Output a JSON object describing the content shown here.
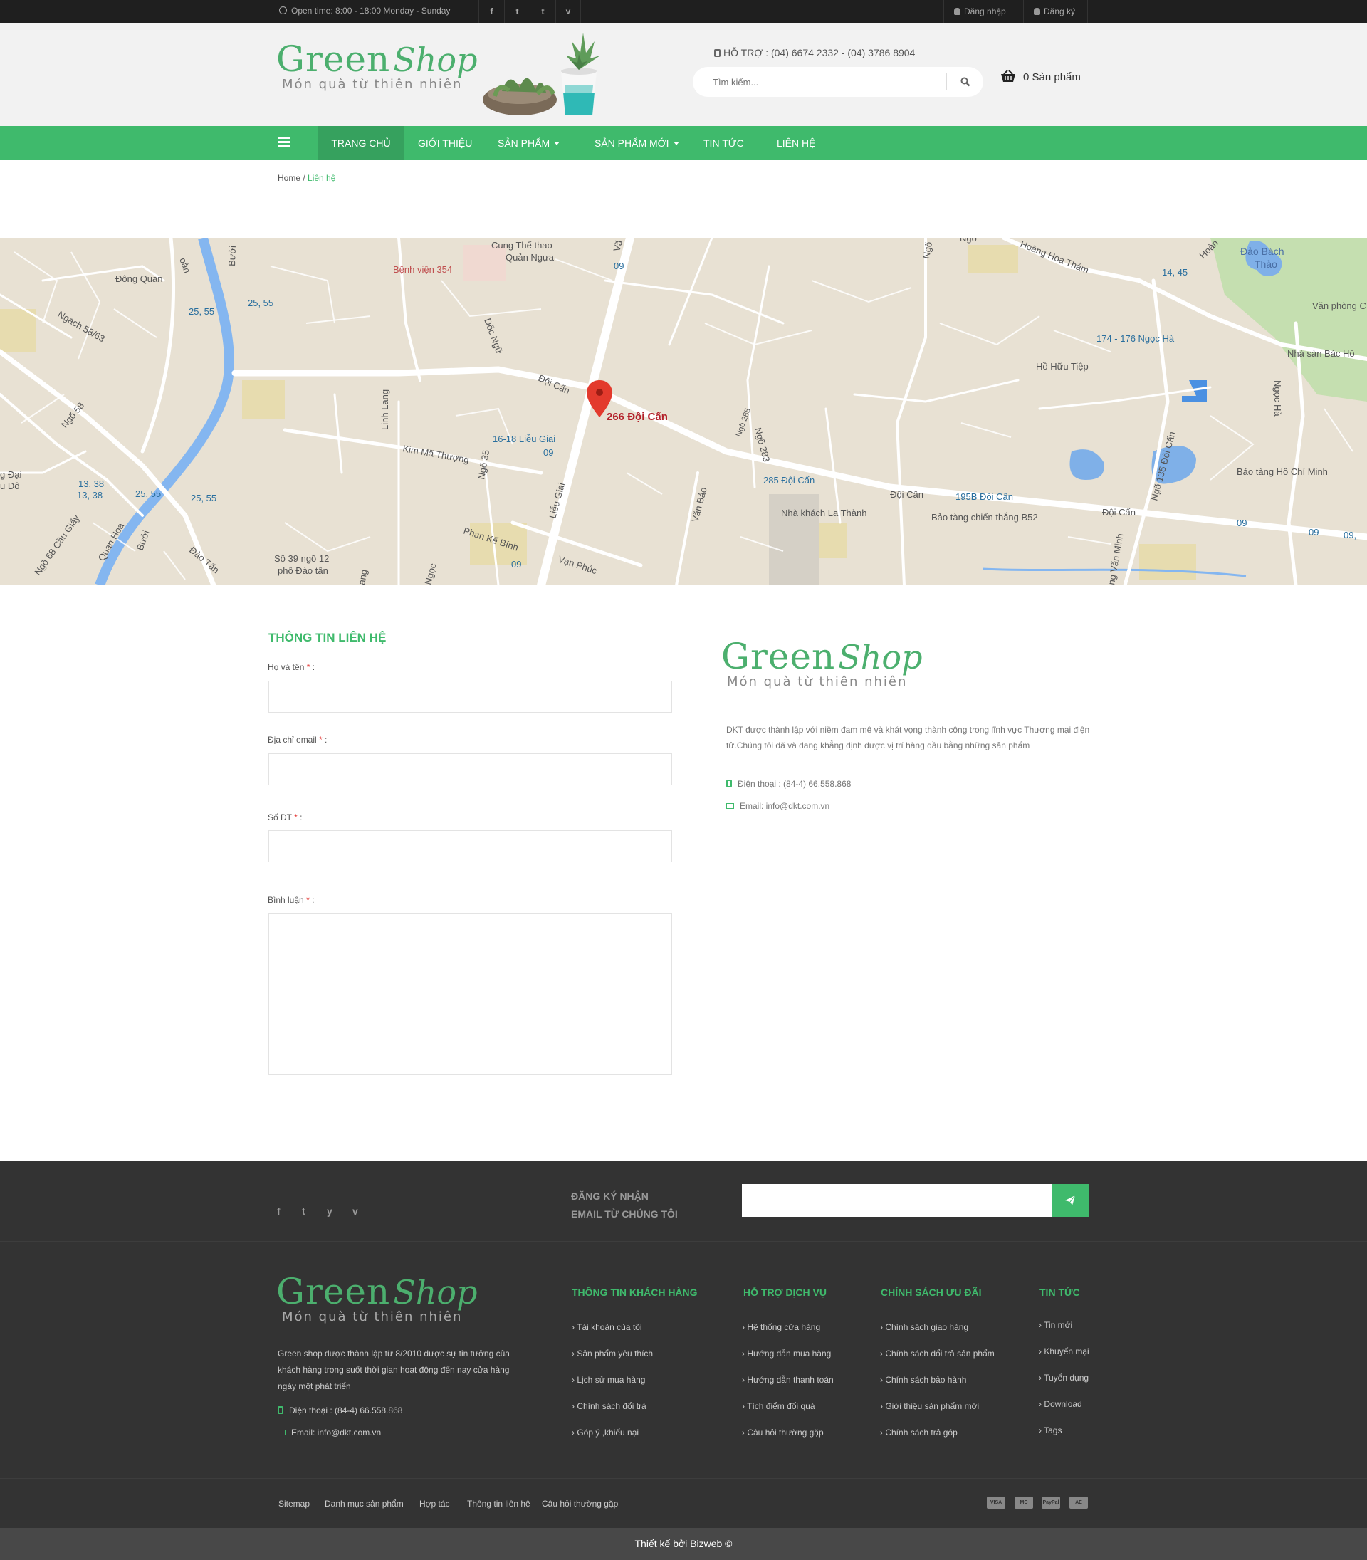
{
  "topbar": {
    "open_time": "Open time: 8:00 - 18:00   Monday - Sunday",
    "social": [
      "f",
      "t",
      "t",
      "v"
    ],
    "login": "Đăng nhập",
    "register": "Đăng ký"
  },
  "header": {
    "logo_green": "Green",
    "logo_shop": "Shop",
    "logo_tagline": "Món quà từ thiên nhiên",
    "hotline": "HỖ TRỢ :  (04) 6674 2332 - (04) 3786 8904",
    "search_placeholder": "Tìm kiếm...",
    "cart_label": "0 Sản phẩm"
  },
  "nav": {
    "items": [
      "Trang chủ",
      "Giới thiệu",
      "Sản phẩm",
      "Sản phẩm mới",
      "Tin tức",
      "Liên hệ"
    ]
  },
  "breadcrumb": {
    "home": "Home",
    "sep": " / ",
    "current": "Liên hệ"
  },
  "map": {
    "marker_label": "266  Đội Cấn",
    "labels": {
      "l1": "Cung Thể thao",
      "l2": "Quản Ngựa",
      "l3": "Bệnh viện 354",
      "l4": "Đông Quan",
      "l5": "Ngách 58/63",
      "l6": "25, 55",
      "l7": "25, 55",
      "l8": "Ngõ 58",
      "l9": "Linh Lang",
      "l10": "Dốc Ngữ",
      "l11": "Đội Cấn",
      "l12": "16-18 Liễu Giai",
      "l13": "09",
      "l14": "Kim Mã Thượng",
      "l15": "Ngõ 35",
      "l16": "Liễu Giai",
      "l17": "Văn Bảo",
      "l18": "Phan Kế Bính",
      "l19": "Vạn Phúc",
      "l20": "Số 39 ngõ 12",
      "l21": "phố Đào tấn",
      "l22": "Đào Tấn",
      "l23": "Quan Hoa",
      "l24": "Ngõ 68 Cầu Giấy",
      "l25": "13, 38",
      "l26": "13, 38",
      "l27": "25, 55",
      "l28": "25, 55",
      "l29": "Bưởi",
      "l30": "Ngõ 285",
      "l31": "Ngõ 283",
      "l32": "285 Đội Cấn",
      "l33": "Nhà khách La Thành",
      "l34": "Đội Cấn",
      "l35": "195B Đội Cấn",
      "l36": "Bảo tàng chiến thắng B52",
      "l37": "Đội Cấn",
      "l38": "Hoàng Hoa Thám",
      "l39": "14, 45",
      "l40": "Đảo Bách",
      "l41": "Thảo",
      "l42": "Văn phòng C",
      "l43": "174 - 176 Ngọc Hà",
      "l44": "Nhà sàn Bác Hồ",
      "l45": "Hồ Hữu Tiệp",
      "l46": "Ngọc Hà",
      "l47": "Ngõ 135 Đội Cấn",
      "l48": "Bảo tàng Hồ Chí Minh",
      "l49": "09",
      "l50": "09",
      "l51": "09,",
      "l52": "Ngõ",
      "l53": "ng Văn Minh",
      "l54": "09",
      "l55": "Ngõ",
      "l56": "Vă",
      "l57": "g Đại",
      "l58": "u Đô",
      "l59": "Ngọc",
      "l60": "ang",
      "l61": "Bưởi",
      "l62": "09",
      "l63": "oàn",
      "l64": "Hoàn"
    }
  },
  "contact_form": {
    "title": "Thông tin liên hệ",
    "name_label": "Họ và tên",
    "email_label": "Địa chỉ email",
    "phone_label": "Số ĐT",
    "comment_label": "Bình luận",
    "required_mark": "*",
    "colon": " :"
  },
  "contact_info": {
    "desc": "DKT được thành lập với niềm đam mê và khát vọng thành công trong lĩnh vực Thương mại điện tử.Chúng tôi đã và đang khẳng định được vị trí hàng đầu bằng những sản phẩm",
    "phone": "Điện thoại : (84-4) 66.558.868",
    "email": "Email: info@dkt.com.vn"
  },
  "newsletter": {
    "line1": "Đăng ký nhận",
    "line2": "email từ chúng tôi",
    "social": [
      "f",
      "t",
      "y",
      "v"
    ]
  },
  "footer": {
    "desc": "Green shop được thành lập từ 8/2010 được sự tin tưởng của khách hàng trong suốt thời gian hoạt động đến nay cửa hàng ngày một phát triển",
    "phone": "Điện thoại : (84-4) 66.558.868",
    "email": "Email: info@dkt.com.vn",
    "columns": [
      {
        "title": "Thông tin khách hàng",
        "links": [
          "Tài khoản của tôi",
          "Sản phẩm yêu thích",
          "Lịch sử mua hàng",
          "Chính sách đổi trả",
          "Góp ý ,khiếu nại"
        ]
      },
      {
        "title": "Hỗ trợ dịch vụ",
        "links": [
          "Hệ thống cửa hàng",
          "Hướng dẫn mua hàng",
          "Hướng dẫn thanh toán",
          "Tích điểm đổi quà",
          "Câu hỏi thường gặp"
        ]
      },
      {
        "title": "Chính sách ưu đãi",
        "links": [
          "Chính sách giao hàng",
          "Chính sách đổi trả sản phẩm",
          "Chính sách bảo hành",
          "Giới thiệu sản phẩm mới",
          "Chính sách trả góp"
        ]
      },
      {
        "title": "Tin tức",
        "links": [
          "Tin mới",
          "Khuyến mại",
          "Tuyển dụng",
          "Download",
          "Tags"
        ]
      }
    ],
    "bottom_links": [
      "Sitemap",
      "Danh mục sản phẩm",
      "Hợp tác",
      "Thông tin liên hệ",
      "Câu hỏi thường gặp"
    ],
    "payments": [
      "VISA",
      "MC",
      "PayPal",
      "AE"
    ],
    "copyright": "Thiết kế  bởi Bizweb ©"
  },
  "colors": {
    "brand_green": "#3fba6c",
    "dark": "#333333",
    "topbar": "#1f1f1f"
  }
}
